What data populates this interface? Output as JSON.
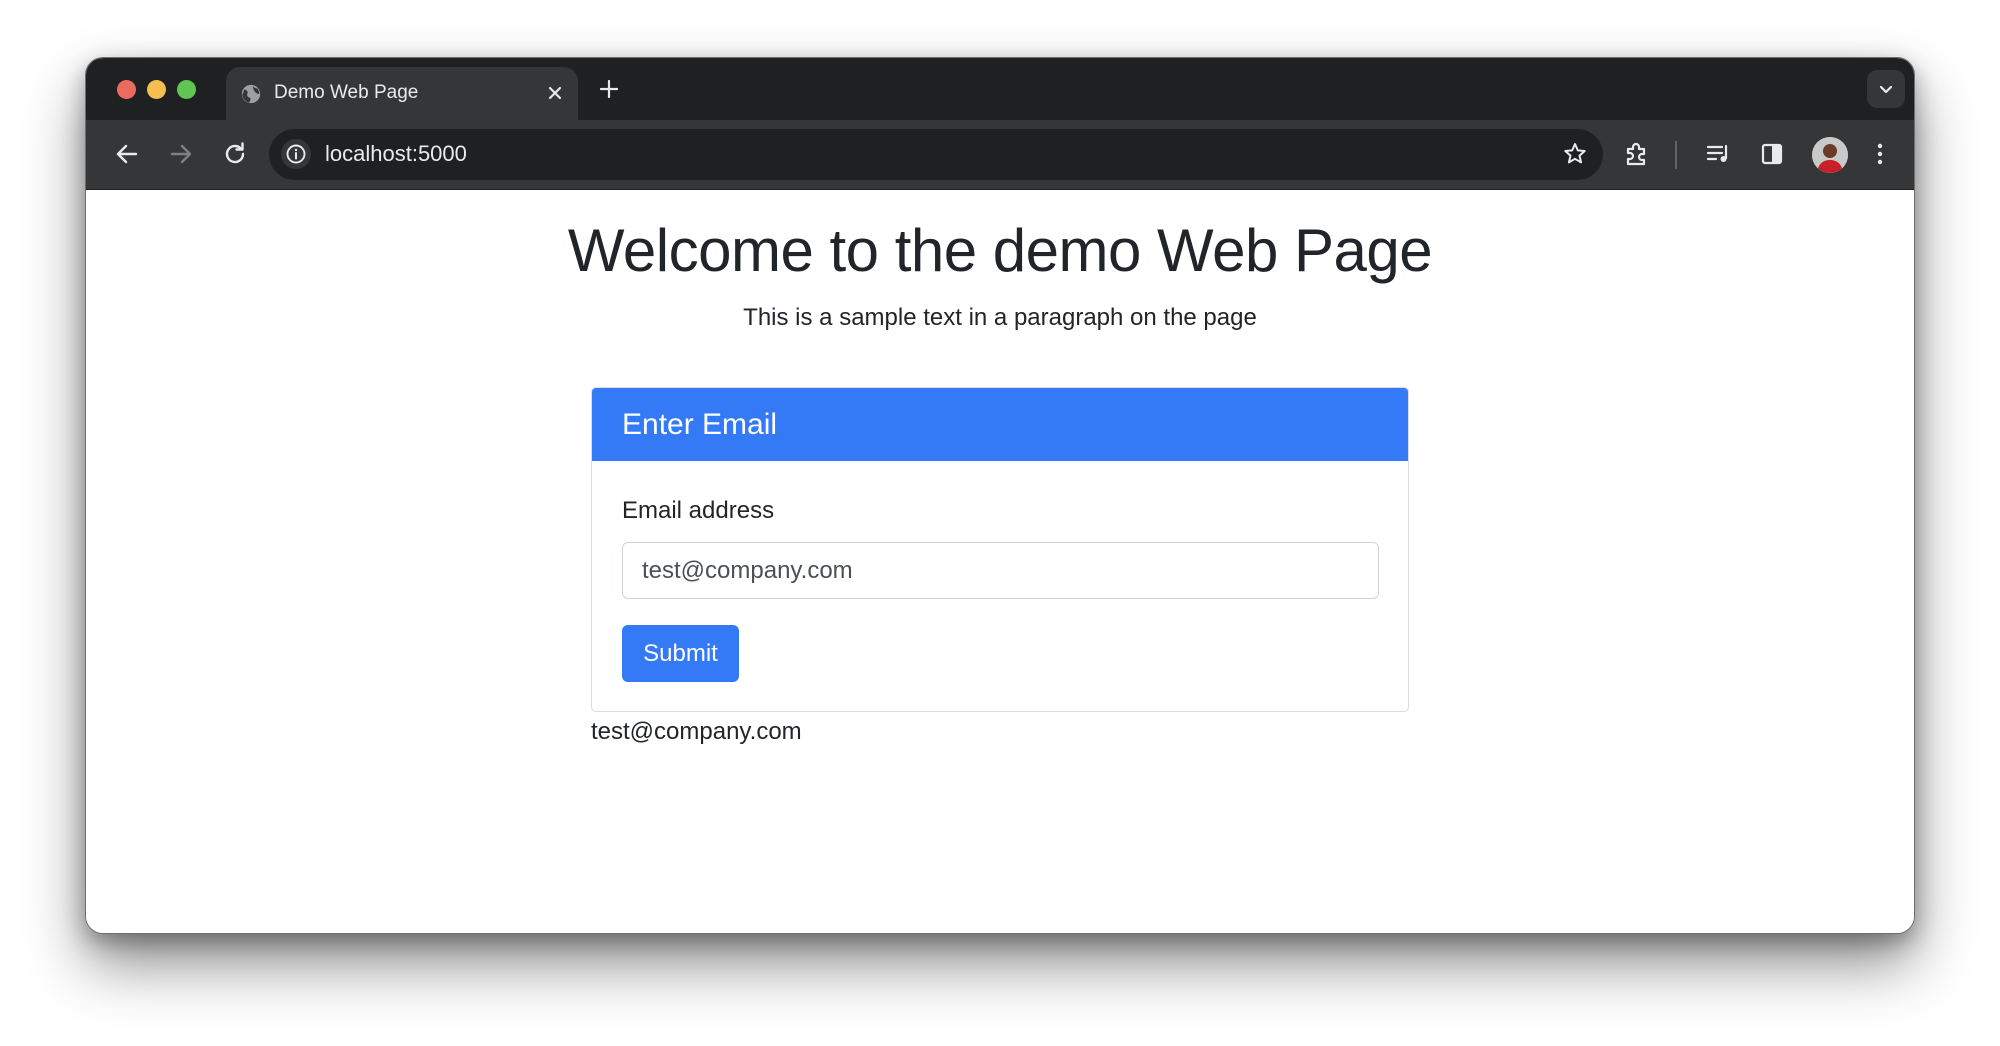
{
  "browser": {
    "tab": {
      "title": "Demo Web Page",
      "favicon": "globe-icon"
    },
    "omnibox": {
      "url": "localhost:5000"
    },
    "icons": {
      "back": "arrow-left-icon",
      "forward": "arrow-right-icon",
      "reload": "reload-icon",
      "site_info": "info-icon",
      "bookmark": "star-icon",
      "extensions": "puzzle-icon",
      "media": "media-control-icon",
      "side_panel": "side-panel-icon",
      "profile": "avatar",
      "menu": "kebab-menu-icon"
    }
  },
  "page": {
    "heading": "Welcome to the demo Web Page",
    "paragraph": "This is a sample text in a paragraph on the page",
    "card": {
      "header": "Enter Email",
      "label": "Email address",
      "input_value": "test@company.com",
      "submit_label": "Submit"
    },
    "result": "test@company.com"
  },
  "colors": {
    "primary": "#3479f5",
    "titlebar": "#1f2021",
    "toolbar": "#353637",
    "text": "#212529"
  }
}
